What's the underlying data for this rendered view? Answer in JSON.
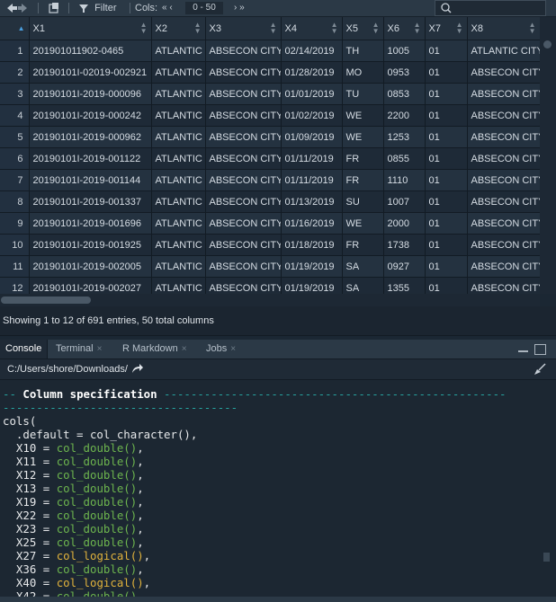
{
  "toolbar": {
    "filter_label": "Filter",
    "cols_label": "Cols:",
    "cols_range": "0 - 50",
    "prev_icon": "double-chevron-left",
    "next_icon": "double-chevron-right"
  },
  "table": {
    "columns": [
      "X1",
      "X2",
      "X3",
      "X4",
      "X5",
      "X6",
      "X7",
      "X8"
    ],
    "rows": [
      {
        "n": "1",
        "cells": [
          "201901011902-0465",
          "ATLANTIC",
          "ABSECON CITY",
          "02/14/2019",
          "TH",
          "1005",
          "01",
          "ATLANTIC CITY"
        ]
      },
      {
        "n": "2",
        "cells": [
          "20190101I-02019-002921",
          "ATLANTIC",
          "ABSECON CITY",
          "01/28/2019",
          "MO",
          "0953",
          "01",
          "ABSECON CITY"
        ]
      },
      {
        "n": "3",
        "cells": [
          "20190101I-2019-000096",
          "ATLANTIC",
          "ABSECON CITY",
          "01/01/2019",
          "TU",
          "0853",
          "01",
          "ABSECON CITY"
        ]
      },
      {
        "n": "4",
        "cells": [
          "20190101I-2019-000242",
          "ATLANTIC",
          "ABSECON CITY",
          "01/02/2019",
          "WE",
          "2200",
          "01",
          "ABSECON CITY"
        ]
      },
      {
        "n": "5",
        "cells": [
          "20190101I-2019-000962",
          "ATLANTIC",
          "ABSECON CITY",
          "01/09/2019",
          "WE",
          "1253",
          "01",
          "ABSECON CITY"
        ]
      },
      {
        "n": "6",
        "cells": [
          "20190101I-2019-001122",
          "ATLANTIC",
          "ABSECON CITY",
          "01/11/2019",
          "FR",
          "0855",
          "01",
          "ABSECON CITY"
        ]
      },
      {
        "n": "7",
        "cells": [
          "20190101I-2019-001144",
          "ATLANTIC",
          "ABSECON CITY",
          "01/11/2019",
          "FR",
          "1110",
          "01",
          "ABSECON CITY"
        ]
      },
      {
        "n": "8",
        "cells": [
          "20190101I-2019-001337",
          "ATLANTIC",
          "ABSECON CITY",
          "01/13/2019",
          "SU",
          "1007",
          "01",
          "ABSECON CITY"
        ]
      },
      {
        "n": "9",
        "cells": [
          "20190101I-2019-001696",
          "ATLANTIC",
          "ABSECON CITY",
          "01/16/2019",
          "WE",
          "2000",
          "01",
          "ABSECON CITY"
        ]
      },
      {
        "n": "10",
        "cells": [
          "20190101I-2019-001925",
          "ATLANTIC",
          "ABSECON CITY",
          "01/18/2019",
          "FR",
          "1738",
          "01",
          "ABSECON CITY"
        ]
      },
      {
        "n": "11",
        "cells": [
          "20190101I-2019-002005",
          "ATLANTIC",
          "ABSECON CITY",
          "01/19/2019",
          "SA",
          "0927",
          "01",
          "ABSECON CITY"
        ]
      },
      {
        "n": "12",
        "cells": [
          "20190101I-2019-002027",
          "ATLANTIC",
          "ABSECON CITY",
          "01/19/2019",
          "SA",
          "1355",
          "01",
          "ABSECON CITY"
        ]
      }
    ]
  },
  "status": {
    "text": "Showing 1 to 12 of 691 entries, 50 total columns"
  },
  "console": {
    "tabs": [
      "Console",
      "Terminal",
      "R Markdown",
      "Jobs"
    ],
    "tab_close": "×",
    "path": "C:/Users/shore/Downloads/",
    "lines": [
      {
        "parts": [
          {
            "t": "-- ",
            "c": "dash"
          },
          {
            "t": "Column specification",
            "c": "hd"
          },
          {
            "t": " ---------------------------------------------------",
            "c": "dash"
          }
        ]
      },
      {
        "parts": [
          {
            "t": "-----------------------------------",
            "c": "dash"
          }
        ]
      },
      {
        "parts": [
          {
            "t": "cols(",
            "c": ""
          }
        ]
      },
      {
        "parts": [
          {
            "t": "  .default = col_character(),",
            "c": ""
          }
        ]
      },
      {
        "parts": [
          {
            "t": "  X10 = ",
            "c": ""
          },
          {
            "t": "col_double()",
            "c": "dbl"
          },
          {
            "t": ",",
            "c": ""
          }
        ]
      },
      {
        "parts": [
          {
            "t": "  X11 = ",
            "c": ""
          },
          {
            "t": "col_double()",
            "c": "dbl"
          },
          {
            "t": ",",
            "c": ""
          }
        ]
      },
      {
        "parts": [
          {
            "t": "  X12 = ",
            "c": ""
          },
          {
            "t": "col_double()",
            "c": "dbl"
          },
          {
            "t": ",",
            "c": ""
          }
        ]
      },
      {
        "parts": [
          {
            "t": "  X13 = ",
            "c": ""
          },
          {
            "t": "col_double()",
            "c": "dbl"
          },
          {
            "t": ",",
            "c": ""
          }
        ]
      },
      {
        "parts": [
          {
            "t": "  X19 = ",
            "c": ""
          },
          {
            "t": "col_double()",
            "c": "dbl"
          },
          {
            "t": ",",
            "c": ""
          }
        ]
      },
      {
        "parts": [
          {
            "t": "  X22 = ",
            "c": ""
          },
          {
            "t": "col_double()",
            "c": "dbl"
          },
          {
            "t": ",",
            "c": ""
          }
        ]
      },
      {
        "parts": [
          {
            "t": "  X23 = ",
            "c": ""
          },
          {
            "t": "col_double()",
            "c": "dbl"
          },
          {
            "t": ",",
            "c": ""
          }
        ]
      },
      {
        "parts": [
          {
            "t": "  X25 = ",
            "c": ""
          },
          {
            "t": "col_double()",
            "c": "dbl"
          },
          {
            "t": ",",
            "c": ""
          }
        ]
      },
      {
        "parts": [
          {
            "t": "  X27 = ",
            "c": ""
          },
          {
            "t": "col_logical()",
            "c": "lgl"
          },
          {
            "t": ",",
            "c": ""
          }
        ]
      },
      {
        "parts": [
          {
            "t": "  X36 = ",
            "c": ""
          },
          {
            "t": "col_double()",
            "c": "dbl"
          },
          {
            "t": ",",
            "c": ""
          }
        ]
      },
      {
        "parts": [
          {
            "t": "  X40 = ",
            "c": ""
          },
          {
            "t": "col_logical()",
            "c": "lgl"
          },
          {
            "t": ",",
            "c": ""
          }
        ]
      },
      {
        "parts": [
          {
            "t": "  X42 = ",
            "c": ""
          },
          {
            "t": "col_double()",
            "c": "dbl"
          },
          {
            "t": ",",
            "c": ""
          }
        ]
      }
    ]
  },
  "colors": {
    "background": "#1b2733",
    "double": "#6db54e",
    "logical": "#e0b23c",
    "rule": "#26a39f"
  }
}
